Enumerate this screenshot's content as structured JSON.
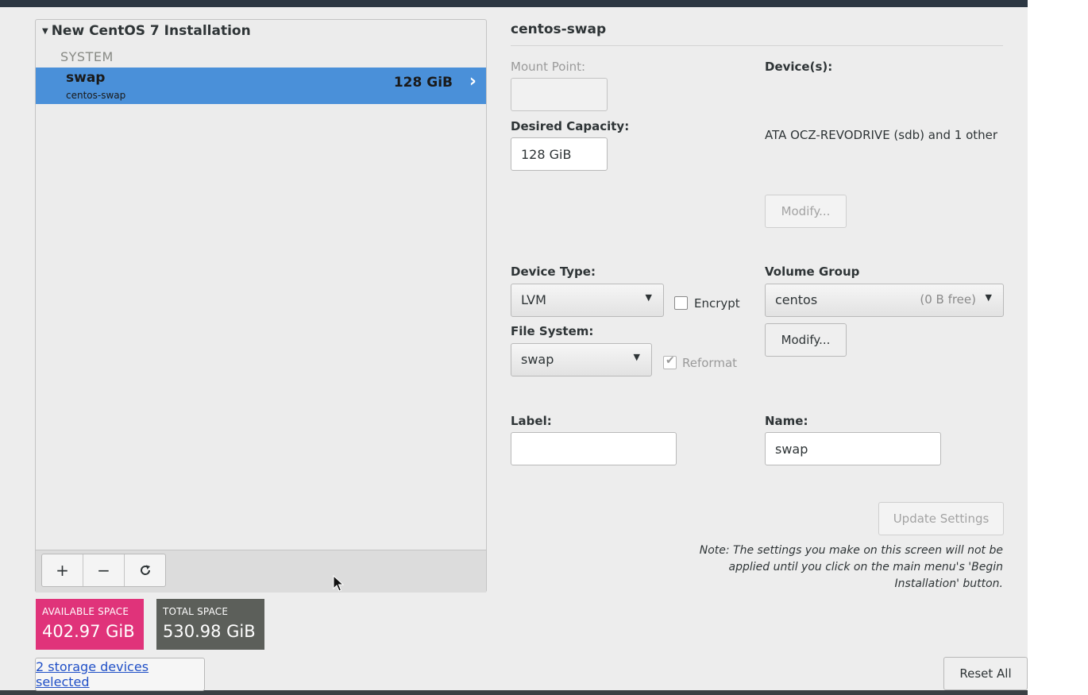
{
  "left": {
    "tree_title": "New CentOS 7 Installation",
    "section": "SYSTEM",
    "selected_mount": {
      "name": "swap",
      "sub": "centos-swap",
      "size": "128 GiB"
    },
    "toolbar": {
      "add": "+",
      "remove": "−",
      "refresh": "↻"
    }
  },
  "space": {
    "available_label": "AVAILABLE SPACE",
    "available_value": "402.97 GiB",
    "total_label": "TOTAL SPACE",
    "total_value": "530.98 GiB",
    "storage_link": "2 storage devices selected",
    "colors": {
      "available": "#e0337a",
      "total": "#5c5f5a"
    }
  },
  "right": {
    "title": "centos-swap",
    "mount_point_label": "Mount Point:",
    "mount_point_value": "",
    "desired_capacity_label": "Desired Capacity:",
    "desired_capacity_value": "128 GiB",
    "devices_label": "Device(s):",
    "devices_value": "ATA OCZ-REVODRIVE (sdb) and 1 other",
    "modify_devices": "Modify...",
    "device_type_label": "Device Type:",
    "device_type_value": "LVM",
    "encrypt_label": "Encrypt",
    "encrypt_checked": false,
    "volume_group_label": "Volume Group",
    "volume_group_value": "centos",
    "volume_group_free": "(0 B free)",
    "modify_vg": "Modify...",
    "file_system_label": "File System:",
    "file_system_value": "swap",
    "reformat_label": "Reformat",
    "reformat_checked": true,
    "label_label": "Label:",
    "label_value": "",
    "name_label": "Name:",
    "name_value": "swap",
    "update_button": "Update Settings",
    "note": "Note:  The settings you make on this screen will not be applied until you click on the main menu's 'Begin Installation' button.",
    "reset_button": "Reset All"
  },
  "accent": "#4a90d9"
}
